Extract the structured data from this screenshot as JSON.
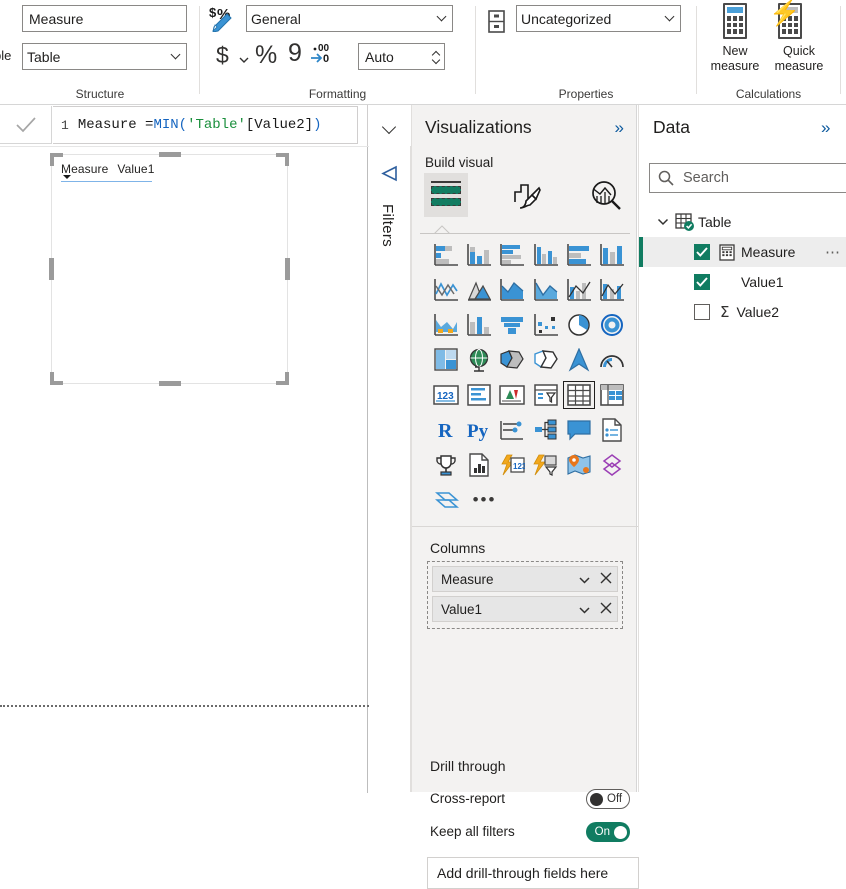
{
  "ribbon": {
    "groups": [
      {
        "caption": "Structure"
      },
      {
        "caption": "Formatting"
      },
      {
        "caption": "Properties"
      },
      {
        "caption": "Calculations"
      }
    ],
    "structure": {
      "name_value": "Measure",
      "home_table_label": "ble",
      "home_table_value": "Table"
    },
    "formatting": {
      "format_icon": "currency-percent-pencil-icon",
      "format_value": "General",
      "currency_glyph": "$",
      "percent_glyph": "%",
      "thousands_glyph": "9",
      "decimals_icon": "decrease-decimal-icon",
      "decimal_places_value": "Auto"
    },
    "properties": {
      "category_icon": "data-category-icon",
      "data_category_value": "Uncategorized"
    },
    "calculations": {
      "new_measure_line1": "New",
      "new_measure_line2": "measure",
      "quick_measure_line1": "Quick",
      "quick_measure_line2": "measure"
    }
  },
  "formula_bar": {
    "commit_icon": "checkmark-icon",
    "line_number": "1",
    "expression_plain_1": "Measure = ",
    "expression_function": "MIN",
    "expression_open": "(",
    "expression_table": "'Table'",
    "expression_column": "[Value2]",
    "expression_close": ")",
    "expand_icon": "chevron-down-icon",
    "full_expression": "Measure = MIN('Table'[Value2])"
  },
  "canvas": {
    "visual": {
      "type": "table-visual",
      "columns": [
        "Measure",
        "Value1"
      ]
    }
  },
  "filters_pane": {
    "label": "Filters",
    "icon": "filter-funnel-icon"
  },
  "visualizations": {
    "title": "Visualizations",
    "collapse_icon": "double-chevron-right-icon",
    "section_label": "Build visual",
    "tabs": [
      {
        "name": "build-visual",
        "icon": "fields-icon",
        "selected": true
      },
      {
        "name": "format-visual",
        "icon": "paintbrush-icon",
        "selected": false
      },
      {
        "name": "analytics",
        "icon": "magnifier-chart-icon",
        "selected": false
      }
    ],
    "gallery": [
      [
        "stacked-bar-chart",
        "stacked-column-chart",
        "clustered-bar-chart",
        "clustered-column-chart",
        "hundred-percent-stacked-bar-chart",
        "hundred-percent-stacked-column-chart"
      ],
      [
        "line-chart",
        "area-chart",
        "stacked-area-chart",
        "line-and-stacked-column-chart",
        "line-and-clustered-column-chart",
        "ribbon-chart"
      ],
      [
        "waterfall-chart",
        "funnel-chart",
        "funnel-chart-2",
        "scatter-chart",
        "pie-chart",
        "donut-chart"
      ],
      [
        "treemap",
        "map",
        "filled-map",
        "shape-map",
        "azure-map",
        "gauge-chart"
      ],
      [
        "card",
        "multi-row-card",
        "kpi",
        "slicer",
        "table",
        "matrix"
      ],
      [
        "r-script-visual",
        "python-visual",
        "decomposition-tree",
        "key-influencers",
        "q-and-a",
        "smart-narrative"
      ],
      [
        "paginated-report",
        "report-page-visual",
        "power-apps",
        "power-automate",
        "arcgis-map",
        "azure-ml-visual"
      ],
      [
        "power-bi-visual",
        "more-options"
      ]
    ],
    "selected_visual": "table",
    "columns_section_label": "Columns",
    "columns_fields": [
      {
        "name": "Measure",
        "dropdown_icon": "chevron-down-icon",
        "remove_icon": "close-x-icon"
      },
      {
        "name": "Value1",
        "dropdown_icon": "chevron-down-icon",
        "remove_icon": "close-x-icon"
      }
    ],
    "drill_through_label": "Drill through",
    "cross_report_label": "Cross-report",
    "cross_report_state": "Off",
    "keep_all_filters_label": "Keep all filters",
    "keep_all_filters_state": "On",
    "drill_drop_placeholder": "Add drill-through fields here"
  },
  "data_pane": {
    "title": "Data",
    "collapse_icon": "double-chevron-right-icon",
    "search_icon": "search-icon",
    "search_placeholder": "Search",
    "tree": [
      {
        "label": "Table",
        "level": 0,
        "expand_icon": "chevron-down-icon",
        "item_icon": "table-checked-icon",
        "checkbox": null,
        "highlighted": false
      },
      {
        "label": "Measure",
        "level": 1,
        "item_icon": "calculator-icon",
        "checkbox": "checked",
        "highlighted": true,
        "overflow_icon": "ellipsis-icon"
      },
      {
        "label": "Value1",
        "level": 1,
        "item_icon": null,
        "checkbox": "checked",
        "highlighted": false
      },
      {
        "label": "Value2",
        "level": 1,
        "item_icon": "sigma-icon",
        "checkbox": "unchecked",
        "highlighted": false
      }
    ]
  },
  "colors": {
    "accent_teal": "#107c61",
    "accent_blue": "#118dff",
    "icon_blue": "#2e86c8",
    "panel_bg": "#f3f2f1",
    "selection_gray": "#e1dfdd",
    "orange": "#f2a81d"
  }
}
